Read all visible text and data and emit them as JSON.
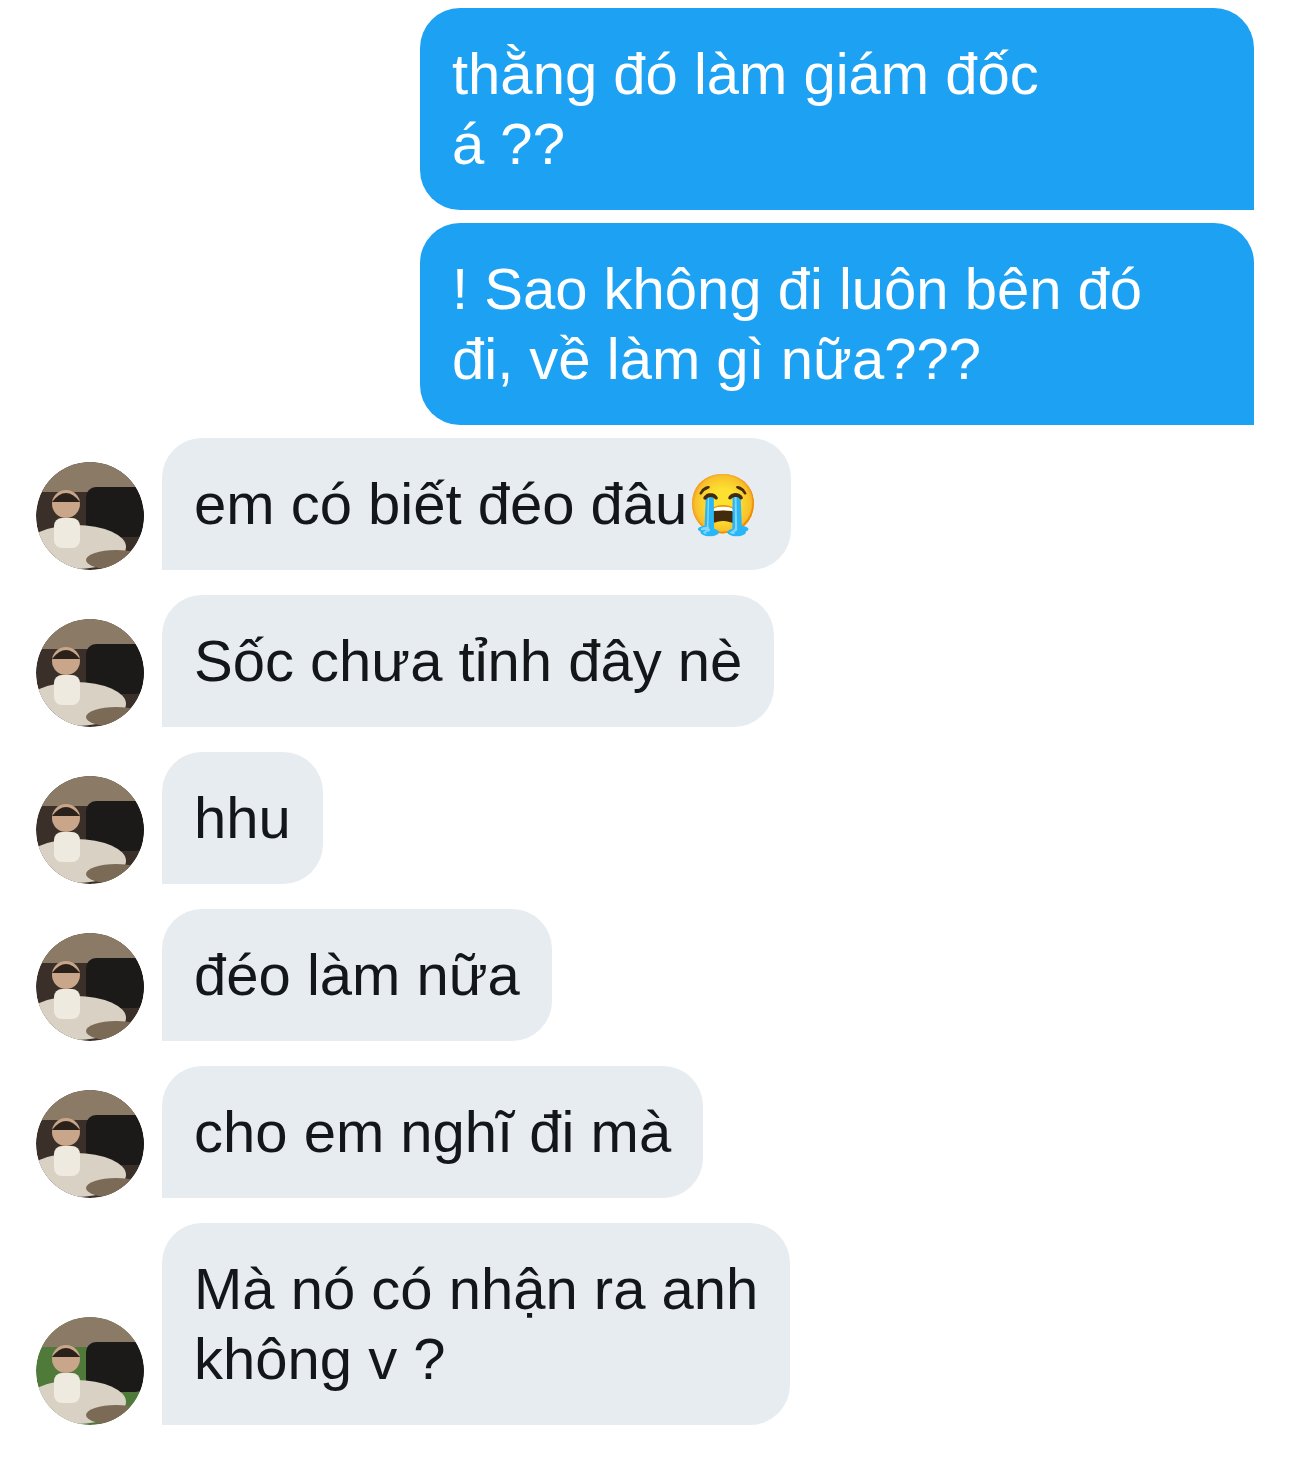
{
  "messages": [
    {
      "kind": "outgoing",
      "text": "thằng đó làm giám đốc\ná ??"
    },
    {
      "kind": "outgoing",
      "text": "! Sao không đi luôn bên đó\nđi, về làm gì nữa???"
    },
    {
      "kind": "incoming",
      "text": "em có biết đéo đâu😭"
    },
    {
      "kind": "incoming",
      "text": "Sốc chưa tỉnh đây nè"
    },
    {
      "kind": "incoming",
      "text": "hhu"
    },
    {
      "kind": "incoming",
      "text": "đéo làm nữa"
    },
    {
      "kind": "incoming",
      "text": "cho em nghĩ đi mà"
    },
    {
      "kind": "incoming",
      "text": "Mà nó có nhận ra anh\nkhông v ?"
    }
  ]
}
